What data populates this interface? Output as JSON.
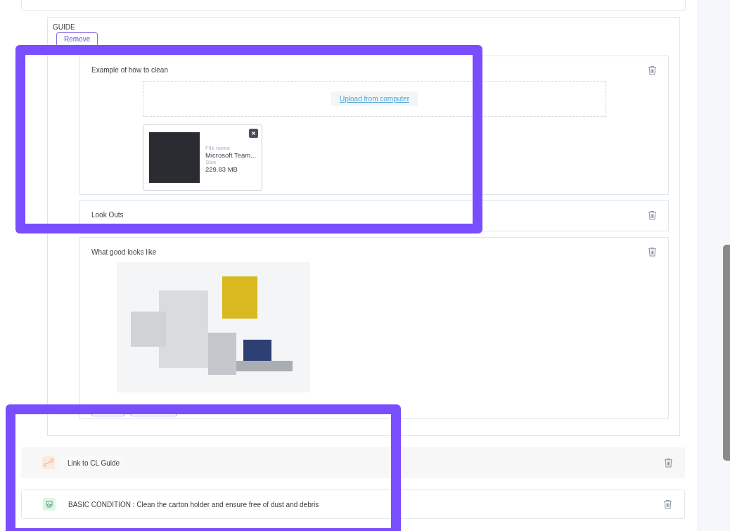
{
  "guide": {
    "title": "GUIDE",
    "remove_button": "Remove",
    "sections": [
      {
        "kind": "upload",
        "title": "Example of how to clean",
        "upload_link": "Upload from computer",
        "file": {
          "name_label": "File name",
          "name": "Microsoft Team...",
          "size_label": "Size",
          "size": "229.83 MB"
        }
      },
      {
        "kind": "text",
        "title": "Look Outs"
      },
      {
        "kind": "image",
        "title": "What good looks like"
      }
    ]
  },
  "rows": [
    {
      "kind": "link",
      "label": "Link to CL Guide"
    },
    {
      "kind": "condition",
      "label": "BASIC CONDITION : Clean the carton holder and ensure free of dust and debris"
    }
  ]
}
